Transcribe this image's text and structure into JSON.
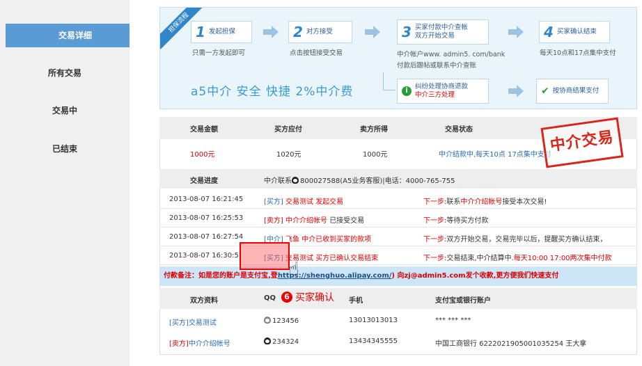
{
  "sidebar": {
    "items": [
      {
        "label": "交易详细",
        "active": true
      },
      {
        "label": "所有交易",
        "active": false
      },
      {
        "label": "交易中",
        "active": false
      },
      {
        "label": "已结束",
        "active": false
      }
    ]
  },
  "flow": {
    "ribbon": "担保流程",
    "steps": [
      {
        "num": "1",
        "label": "发起担保",
        "desc": "只需一方发起即可"
      },
      {
        "num": "2",
        "label": "对方接受",
        "desc": "点击按钮接受交易"
      },
      {
        "num": "3",
        "label_line1": "买家付款中介查帐",
        "label_line2": "双方开始交易",
        "desc_line1": "中介帐户www. admin5. com/bank",
        "desc_line2": "付款后跟帖或联系中介查账"
      },
      {
        "num": "4",
        "label": "买家确认结束",
        "desc": "每天10点和17点集中支付"
      }
    ],
    "dispute": {
      "line1": "纠纷处理协商退款",
      "line2": "中介三方处理"
    },
    "agree": {
      "label": "按协商结果支付"
    },
    "slogan": "a5中介  安全 快捷  2%中介费"
  },
  "summary": {
    "headers": [
      "交易金额",
      "买方应付",
      "卖方所得",
      "交易状态"
    ],
    "amount": "1000元",
    "buyer_pays": "1020元",
    "seller_gets": "1000元",
    "status": "中介结款中,每天10点 17点集中支付",
    "stamp": "中介交易"
  },
  "progress": {
    "header": "交易进度",
    "contact_prefix": "中介联系",
    "contact": "800027588(A5业务客服)|电话：4000-765-755",
    "rows": [
      {
        "time": "2013-08-07 16:21:45",
        "role": "[买方]",
        "name": "交易测试",
        "action": "发起交易",
        "next_prefix": "下一步:",
        "next_a": "联系",
        "next_b": "中介介绍帐号",
        "next_c": "接受本次交易!"
      },
      {
        "time": "2013-08-07 16:25:53",
        "role": "[卖方]",
        "name": "中介介绍帐号",
        "action": "已接受交易",
        "next_prefix": "下一步:",
        "next_a": "等待买方付款",
        "next_b": "",
        "next_c": ""
      },
      {
        "time": "2013-08-07 16:27:54",
        "role": "[中介]",
        "name": "飞鱼",
        "action": "中介已收到买家的款项",
        "next_prefix": "下一步:",
        "next_a": "双方开始交易，交易完毕以后，提醒买方确认结束，",
        "next_b": "",
        "next_c": ""
      },
      {
        "time": "2013-08-07 16:30:5",
        "role": "[买方]",
        "name": "交易测试",
        "action": "买方已确认交易结束",
        "next_prefix": "下一步:",
        "next_a": "交易结束,中介结算中.",
        "next_b": "每天10:00 17:00两次集中付款",
        "next_c": ""
      }
    ]
  },
  "note": {
    "prefix": "付款备注：如是您的账户是支付宝,登",
    "url": "https://shenghuo.alipay.com/",
    "suffix": "向zj@admin5.com发个收款,更方便我们快速支付"
  },
  "callout": {
    "num": "6",
    "text": "买家确认"
  },
  "parties": {
    "headers": [
      "双方资料",
      "QQ",
      "手机",
      "支付宝或银行账户"
    ],
    "rows": [
      {
        "role": "[买方]",
        "name": "交易测试",
        "qq": "123456",
        "phone": "13013013013",
        "account": "*** *** ***"
      },
      {
        "role": "[卖方]",
        "name": "中介介绍帐号",
        "qq": "234324",
        "phone": "13434345555",
        "account": "中国工商银行 6222021905001035254 王大拿"
      }
    ]
  },
  "colors": {
    "accent": "#5b9bd5",
    "red": "#dd0000",
    "link": "#2b6cb0"
  }
}
